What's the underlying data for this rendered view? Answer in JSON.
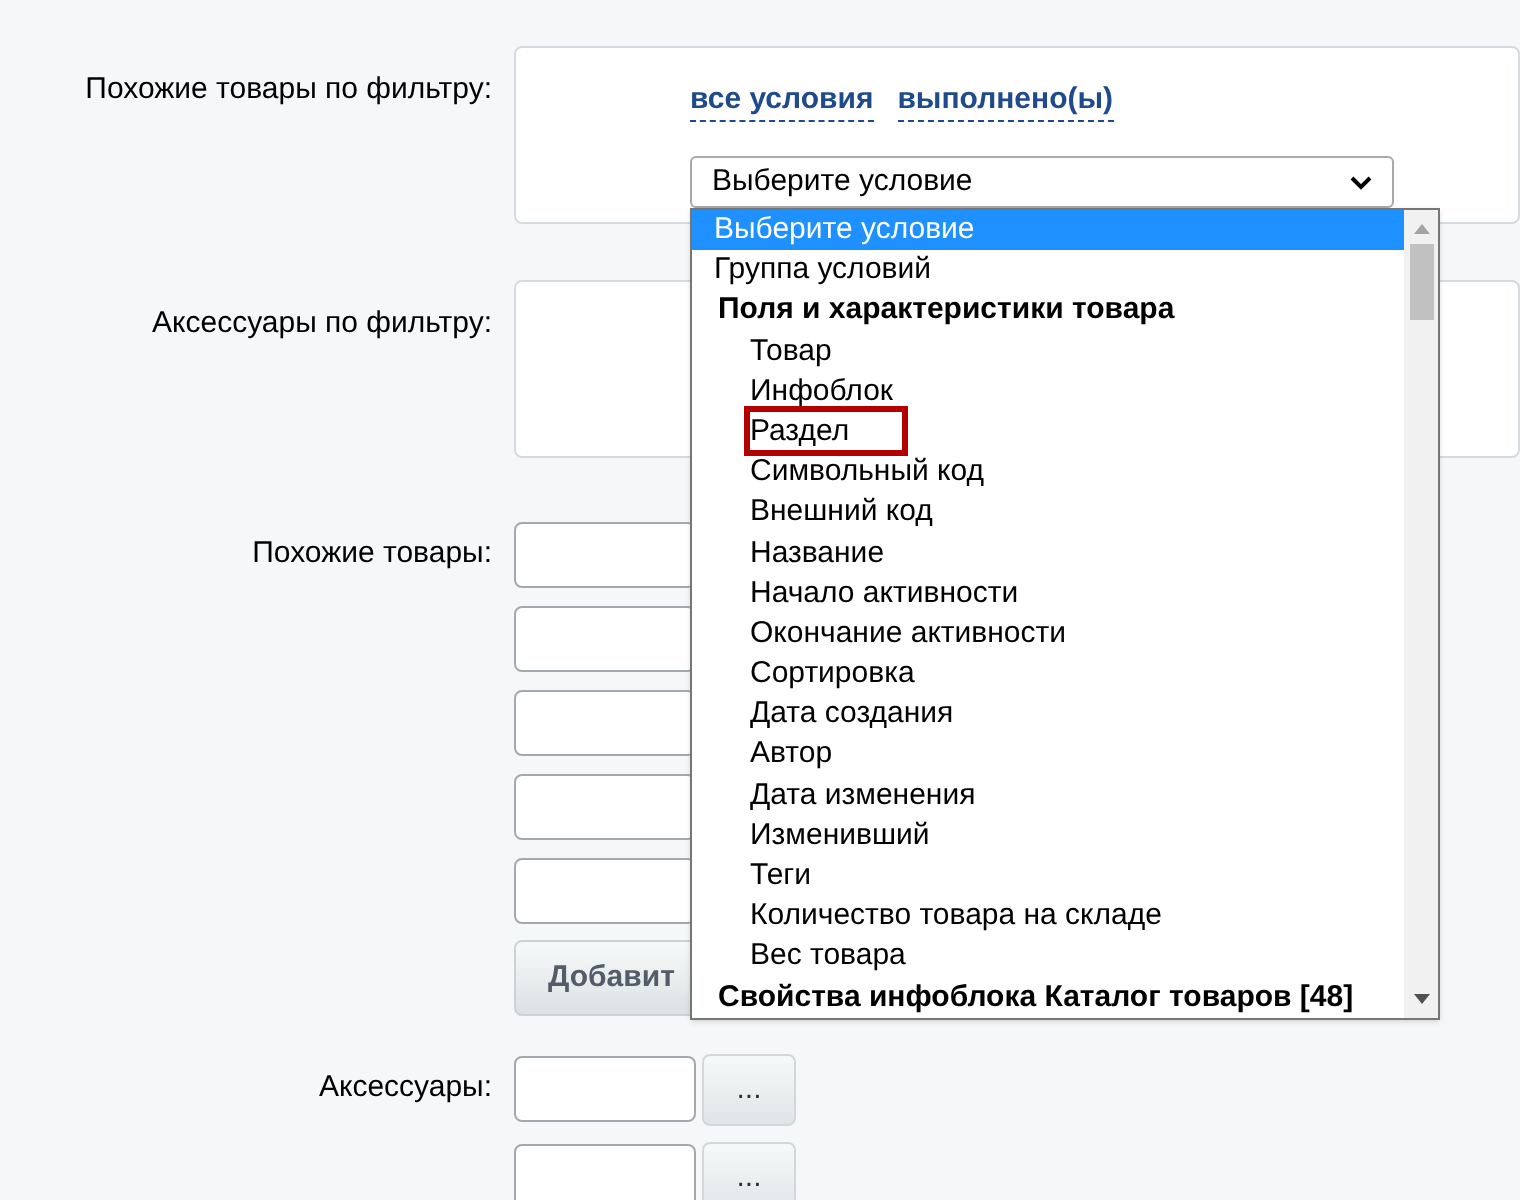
{
  "form": {
    "rows": [
      {
        "label": "Похожие товары по фильтру:",
        "kind": "filter",
        "links": [
          "все условия",
          "выполнено(ы)"
        ],
        "select": {
          "value": "Выберите условие"
        }
      },
      {
        "label": "Аксессуары по фильтру:",
        "kind": "filter"
      },
      {
        "label": "Похожие товары:",
        "kind": "inputs",
        "inputs": [
          {
            "kind": "text"
          },
          {
            "kind": "text"
          },
          {
            "kind": "text"
          },
          {
            "kind": "text"
          },
          {
            "kind": "text"
          }
        ],
        "add_button": "Добавит"
      },
      {
        "label": "Аксессуары:",
        "kind": "inputs",
        "inputs": [
          {
            "kind": "text"
          },
          {
            "kind": "text"
          }
        ],
        "browse_button": "..."
      }
    ]
  },
  "dropdown": {
    "options": [
      {
        "label": "Выберите условие",
        "kind": "option",
        "selected": true,
        "highlighted": false
      },
      {
        "label": "Группа условий",
        "kind": "option",
        "selected": false,
        "highlighted": false
      },
      {
        "label": "Поля и характеристики товара",
        "kind": "group",
        "children": [
          {
            "label": "Товар",
            "selected": false,
            "highlighted": false
          },
          {
            "label": "Инфоблок",
            "selected": false,
            "highlighted": false
          },
          {
            "label": "Раздел",
            "selected": false,
            "highlighted": true
          },
          {
            "label": "Символьный код",
            "selected": false,
            "highlighted": false
          },
          {
            "label": "Внешний код",
            "selected": false,
            "highlighted": false
          },
          {
            "label": "Название",
            "selected": false,
            "highlighted": false
          },
          {
            "label": "Начало активности",
            "selected": false,
            "highlighted": false
          },
          {
            "label": "Окончание активности",
            "selected": false,
            "highlighted": false
          },
          {
            "label": "Сортировка",
            "selected": false,
            "highlighted": false
          },
          {
            "label": "Дата создания",
            "selected": false,
            "highlighted": false
          },
          {
            "label": "Автор",
            "selected": false,
            "highlighted": false
          },
          {
            "label": "Дата изменения",
            "selected": false,
            "highlighted": false
          },
          {
            "label": "Изменивший",
            "selected": false,
            "highlighted": false
          },
          {
            "label": "Теги",
            "selected": false,
            "highlighted": false
          },
          {
            "label": "Количество товара на складе",
            "selected": false,
            "highlighted": false
          },
          {
            "label": "Вес товара",
            "selected": false,
            "highlighted": false
          }
        ]
      },
      {
        "label": "Свойства инфоблока Каталог товаров [48]",
        "kind": "group"
      }
    ]
  }
}
